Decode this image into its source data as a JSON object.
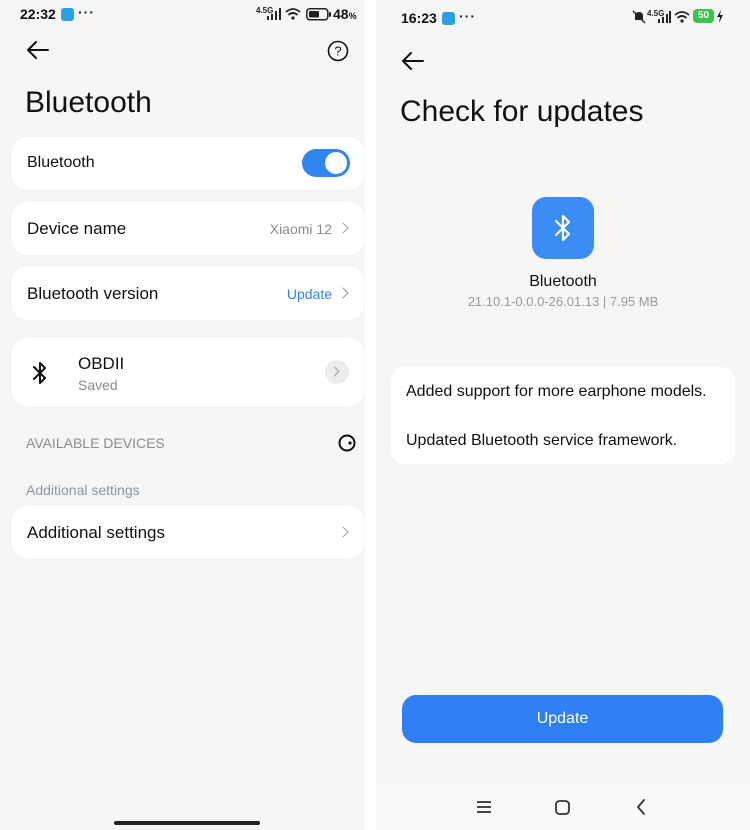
{
  "left": {
    "status": {
      "time": "22:32",
      "dots": "···",
      "network": "4.5G",
      "battery": "48",
      "battery_unit": "%"
    },
    "header": {
      "back_icon": "back-arrow-icon",
      "help_icon": "help-icon",
      "title": "Bluetooth"
    },
    "bluetooth_toggle": {
      "label": "Bluetooth",
      "state": "on"
    },
    "device_name": {
      "label": "Device name",
      "value": "Xiaomi 12"
    },
    "bluetooth_version": {
      "label": "Bluetooth version",
      "value": "Update"
    },
    "paired_device": {
      "icon": "bluetooth-icon",
      "name": "OBDII",
      "status": "Saved"
    },
    "available_devices_label": "AVAILABLE DEVICES",
    "additional_settings_link": "Additional settings",
    "additional_settings_row": "Additional settings"
  },
  "right": {
    "status": {
      "time": "16:23",
      "dots": "···",
      "network": "4.5G",
      "battery": "50"
    },
    "header": {
      "back_icon": "back-arrow-icon",
      "title": "Check for updates"
    },
    "app": {
      "name": "Bluetooth",
      "meta": "21.10.1-0.0.0-26.01.13 | 7.95 MB"
    },
    "changelog": [
      "Added support for more earphone models.",
      "Updated Bluetooth service framework."
    ],
    "update_button": "Update",
    "navbar": [
      "menu-icon",
      "home-icon",
      "back-icon"
    ]
  },
  "colors": {
    "accent": "#2f86f0",
    "app_icon": "#3b8cf5",
    "background": "#f6f6f6"
  }
}
